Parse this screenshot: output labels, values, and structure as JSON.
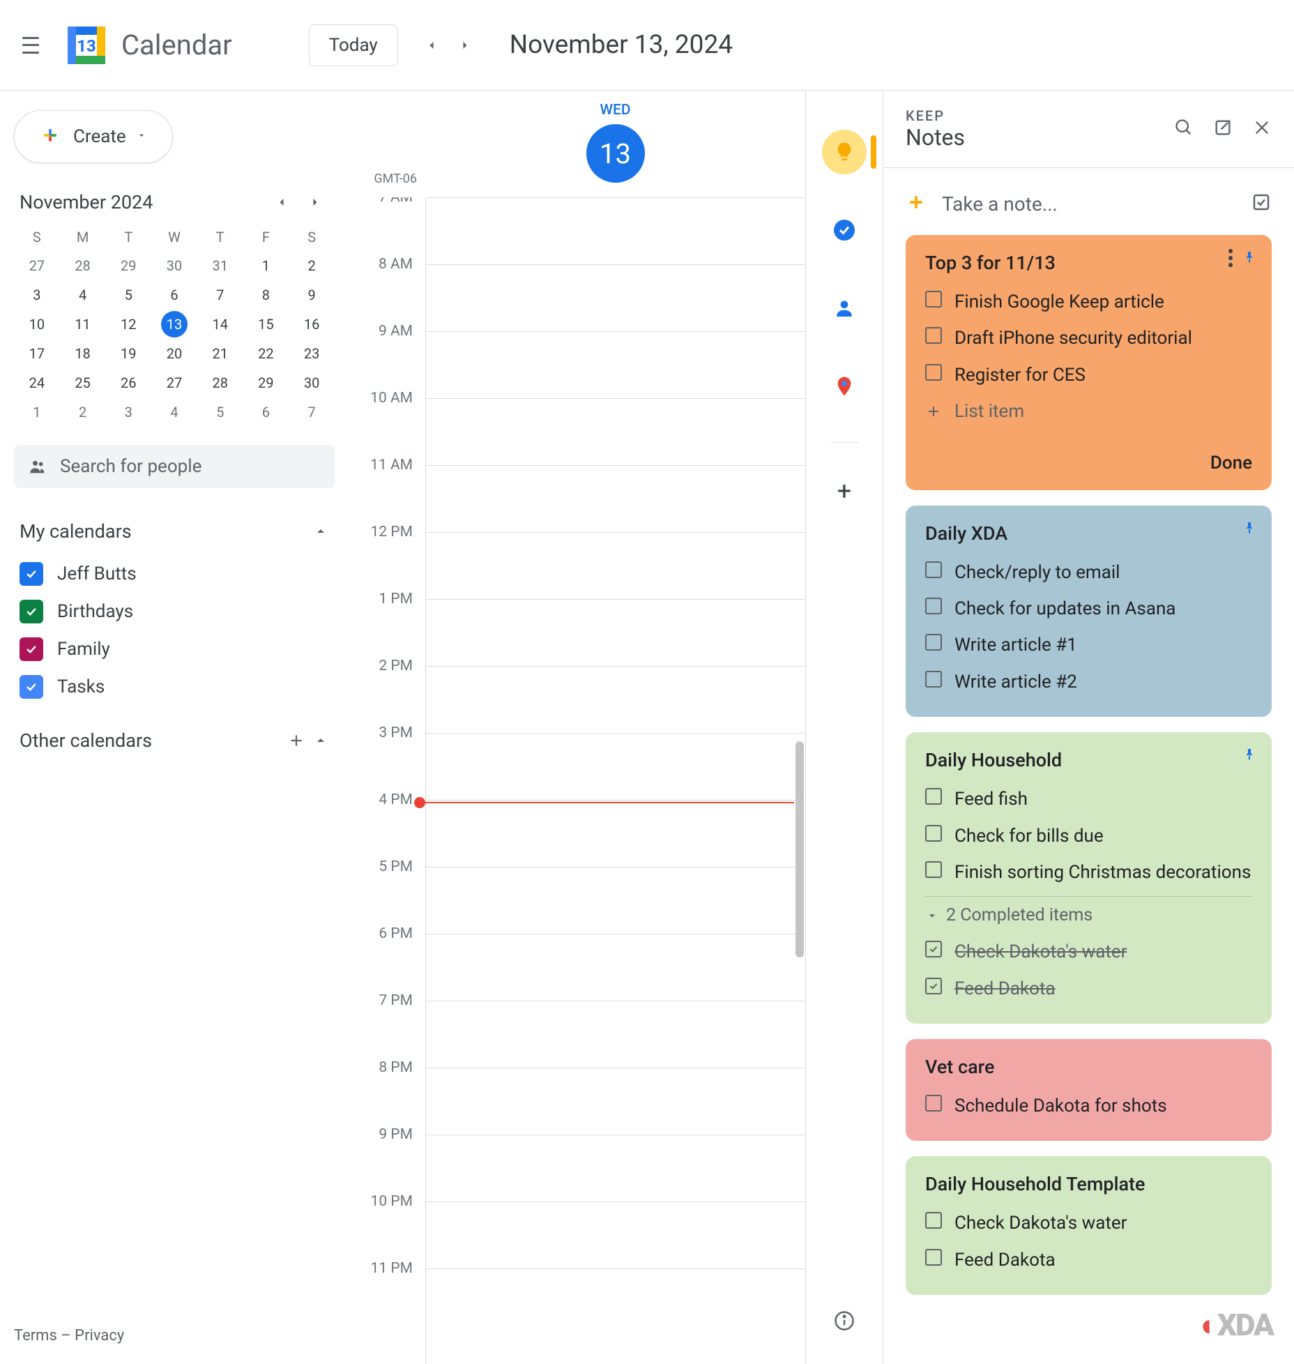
{
  "header": {
    "app_title": "Calendar",
    "today_btn": "Today",
    "date_display": "November 13, 2024"
  },
  "left": {
    "create_label": "Create",
    "mini_cal_title": "November 2024",
    "dow": [
      "S",
      "M",
      "T",
      "W",
      "T",
      "F",
      "S"
    ],
    "weeks": [
      [
        {
          "d": "27",
          "o": true
        },
        {
          "d": "28",
          "o": true
        },
        {
          "d": "29",
          "o": true
        },
        {
          "d": "30",
          "o": true
        },
        {
          "d": "31",
          "o": true
        },
        {
          "d": "1"
        },
        {
          "d": "2"
        }
      ],
      [
        {
          "d": "3"
        },
        {
          "d": "4"
        },
        {
          "d": "5"
        },
        {
          "d": "6"
        },
        {
          "d": "7"
        },
        {
          "d": "8"
        },
        {
          "d": "9"
        }
      ],
      [
        {
          "d": "10"
        },
        {
          "d": "11"
        },
        {
          "d": "12"
        },
        {
          "d": "13",
          "t": true
        },
        {
          "d": "14"
        },
        {
          "d": "15"
        },
        {
          "d": "16"
        }
      ],
      [
        {
          "d": "17"
        },
        {
          "d": "18"
        },
        {
          "d": "19"
        },
        {
          "d": "20"
        },
        {
          "d": "21"
        },
        {
          "d": "22"
        },
        {
          "d": "23"
        }
      ],
      [
        {
          "d": "24"
        },
        {
          "d": "25"
        },
        {
          "d": "26"
        },
        {
          "d": "27"
        },
        {
          "d": "28"
        },
        {
          "d": "29"
        },
        {
          "d": "30"
        }
      ],
      [
        {
          "d": "1",
          "o": true
        },
        {
          "d": "2",
          "o": true
        },
        {
          "d": "3",
          "o": true
        },
        {
          "d": "4",
          "o": true
        },
        {
          "d": "5",
          "o": true
        },
        {
          "d": "6",
          "o": true
        },
        {
          "d": "7",
          "o": true
        }
      ]
    ],
    "search_placeholder": "Search for people",
    "my_calendars_title": "My calendars",
    "calendars": [
      {
        "label": "Jeff Butts",
        "color": "#1a73e8"
      },
      {
        "label": "Birthdays",
        "color": "#0b8043"
      },
      {
        "label": "Family",
        "color": "#ad1457"
      },
      {
        "label": "Tasks",
        "color": "#4285f4"
      }
    ],
    "other_calendars_title": "Other calendars",
    "footer": "Terms – Privacy"
  },
  "day": {
    "tz": "GMT-06",
    "dow": "WED",
    "daynum": "13",
    "hours": [
      "7 AM",
      "8 AM",
      "9 AM",
      "10 AM",
      "11 AM",
      "12 PM",
      "1 PM",
      "2 PM",
      "3 PM",
      "4 PM",
      "5 PM",
      "6 PM",
      "7 PM",
      "8 PM",
      "9 PM",
      "10 PM",
      "11 PM"
    ]
  },
  "keep": {
    "subtitle": "KEEP",
    "title": "Notes",
    "take_note": "Take a note...",
    "list_item_placeholder": "List item",
    "done_label": "Done",
    "notes": [
      {
        "title": "Top 3 for 11/13",
        "color": "orange",
        "pinned": true,
        "menu": true,
        "add": true,
        "done_btn": true,
        "items": [
          {
            "text": "Finish Google Keep article"
          },
          {
            "text": "Draft iPhone security editorial"
          },
          {
            "text": "Register for CES"
          }
        ]
      },
      {
        "title": "Daily XDA",
        "color": "blue",
        "pinned": true,
        "items": [
          {
            "text": "Check/reply to email"
          },
          {
            "text": "Check for updates in Asana"
          },
          {
            "text": "Write article #1"
          },
          {
            "text": "Write article #2"
          }
        ]
      },
      {
        "title": "Daily Household",
        "color": "green",
        "pinned": true,
        "items": [
          {
            "text": "Feed fish"
          },
          {
            "text": "Check for bills due"
          },
          {
            "text": "Finish sorting Christmas decorations"
          }
        ],
        "completed_label": "2 Completed items",
        "completed": [
          {
            "text": "Check Dakota's water"
          },
          {
            "text": "Feed Dakota"
          }
        ]
      },
      {
        "title": "Vet care",
        "color": "red",
        "items": [
          {
            "text": "Schedule Dakota for shots"
          }
        ]
      },
      {
        "title": "Daily Household Template",
        "color": "green",
        "items": [
          {
            "text": "Check Dakota's water"
          },
          {
            "text": "Feed Dakota"
          }
        ]
      }
    ]
  }
}
